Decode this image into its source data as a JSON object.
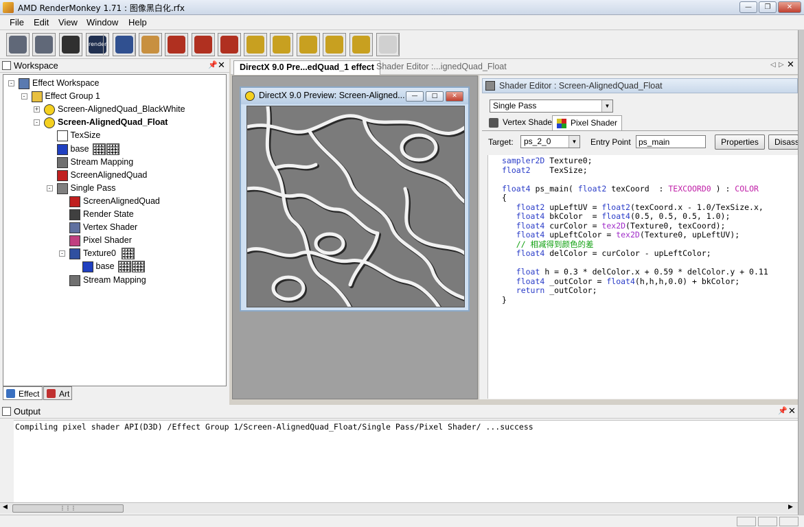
{
  "window": {
    "title": "AMD RenderMonkey 1.71 : 图像黑白化.rfx",
    "icon": "rendermonkey-app-icon"
  },
  "menu": [
    "File",
    "Edit",
    "View",
    "Window",
    "Help"
  ],
  "toolbar": {
    "buttons": [
      {
        "name": "add-vertex-shader-icon",
        "color": "#606878"
      },
      {
        "name": "add-pixel-shader-icon",
        "color": "#606878"
      },
      {
        "name": "compile-icon",
        "color": "#303030"
      },
      {
        "name": "render-icon",
        "color": "#203050",
        "label": "render"
      },
      {
        "name": "sphere-model-icon",
        "color": "#305090"
      },
      {
        "name": "palette-icon",
        "color": "#c89040"
      },
      {
        "name": "add-texture-icon",
        "color": "#b03020"
      },
      {
        "name": "add-variable-icon",
        "color": "#b03020"
      },
      {
        "name": "add-renderstate-icon",
        "color": "#b03020"
      },
      {
        "name": "camera-icon",
        "color": "#c8a020"
      },
      {
        "name": "camera-icon",
        "color": "#c8a020"
      },
      {
        "name": "camera-icon",
        "color": "#c8a020"
      },
      {
        "name": "camera-icon",
        "color": "#c8a020"
      },
      {
        "name": "camera-icon",
        "color": "#c8a020"
      },
      {
        "name": "mouse-icon",
        "color": "#d0d0d0"
      }
    ]
  },
  "workspace": {
    "title": "Workspace",
    "tree": [
      {
        "label": "Effect Workspace",
        "icon": "workspace-icon",
        "depth": 0,
        "expander": "-"
      },
      {
        "label": "Effect Group 1",
        "icon": "folder-icon",
        "depth": 1,
        "expander": "-"
      },
      {
        "label": "Screen-AlignedQuad_BlackWhite",
        "icon": "effect-icon",
        "depth": 2,
        "expander": "+"
      },
      {
        "label": "Screen-AlignedQuad_Float",
        "icon": "effect-icon",
        "depth": 2,
        "expander": "-",
        "bold": true
      },
      {
        "label": "TexSize",
        "icon": "variable-icon",
        "depth": 3
      },
      {
        "label": "base",
        "icon": "texture-icon",
        "depth": 3,
        "thumbs": 2
      },
      {
        "label": "Stream Mapping",
        "icon": "stream-mapping-icon",
        "depth": 3
      },
      {
        "label": "ScreenAlignedQuad",
        "icon": "model-icon",
        "depth": 3
      },
      {
        "label": "Single Pass",
        "icon": "pass-icon",
        "depth": 3,
        "expander": "-"
      },
      {
        "label": "ScreenAlignedQuad",
        "icon": "model-icon",
        "depth": 4
      },
      {
        "label": "Render State",
        "icon": "render-state-icon",
        "depth": 4
      },
      {
        "label": "Vertex Shader",
        "icon": "vertex-shader-icon",
        "depth": 4
      },
      {
        "label": "Pixel Shader",
        "icon": "pixel-shader-icon",
        "depth": 4
      },
      {
        "label": "Texture0",
        "icon": "texture-object-icon",
        "depth": 4,
        "expander": "-",
        "thumbs": 1
      },
      {
        "label": "base",
        "icon": "texture-icon",
        "depth": 5,
        "thumbs": 2
      },
      {
        "label": "Stream Mapping",
        "icon": "stream-mapping-icon",
        "depth": 4
      }
    ],
    "tabs": [
      {
        "label": "Effect",
        "icon": "effect-tab-icon",
        "color": "#3a70c0"
      },
      {
        "label": "Art",
        "icon": "art-tab-icon",
        "color": "#c03030"
      }
    ]
  },
  "documents": {
    "tabs": [
      "DirectX 9.0 Pre...edQuad_1 effect",
      "Shader Editor :...ignedQuad_Float"
    ],
    "preview": {
      "title": "DirectX 9.0 Preview: Screen-Aligned..."
    },
    "shader_editor": {
      "title": "Shader Editor : Screen-AlignedQuad_Float",
      "pass_select": "Single Pass",
      "tabs": [
        "Vertex Shader",
        "Pixel Shader"
      ],
      "target_label": "Target:",
      "target_value": "ps_2_0",
      "entry_label": "Entry Point",
      "entry_value": "ps_main",
      "properties_button": "Properties",
      "disassembly_button": "Disassembly",
      "code": [
        [
          [
            "kw",
            "sampler2D"
          ],
          [
            "t",
            " Texture0;"
          ]
        ],
        [
          [
            "kw",
            "float2"
          ],
          [
            "t",
            "    TexSize;"
          ]
        ],
        [],
        [
          [
            "kw",
            "float4"
          ],
          [
            "t",
            " ps_main( "
          ],
          [
            "kw",
            "float2"
          ],
          [
            "t",
            " texCoord  : "
          ],
          [
            "sem",
            "TEXCOORD0"
          ],
          [
            "t",
            " ) : "
          ],
          [
            "sem",
            "COLOR"
          ]
        ],
        [
          [
            "t",
            "{"
          ]
        ],
        [
          [
            "t",
            "   "
          ],
          [
            "kw",
            "float2"
          ],
          [
            "t",
            " upLeftUV = "
          ],
          [
            "kw",
            "float2"
          ],
          [
            "t",
            "(texCoord.x - 1.0/TexSize.x,"
          ]
        ],
        [
          [
            "t",
            "   "
          ],
          [
            "kw",
            "float4"
          ],
          [
            "t",
            " bkColor  = "
          ],
          [
            "kw",
            "float4"
          ],
          [
            "t",
            "(0.5, 0.5, 0.5, 1.0);"
          ]
        ],
        [
          [
            "t",
            "   "
          ],
          [
            "kw",
            "float4"
          ],
          [
            "t",
            " curColor = "
          ],
          [
            "fn",
            "tex2D"
          ],
          [
            "t",
            "(Texture0, texCoord);"
          ]
        ],
        [
          [
            "t",
            "   "
          ],
          [
            "kw",
            "float4"
          ],
          [
            "t",
            " upLeftColor = "
          ],
          [
            "fn",
            "tex2D"
          ],
          [
            "t",
            "(Texture0, upLeftUV);"
          ]
        ],
        [
          [
            "t",
            "   "
          ],
          [
            "cm",
            "// 相减得到颜色的差"
          ]
        ],
        [
          [
            "t",
            "   "
          ],
          [
            "kw",
            "float4"
          ],
          [
            "t",
            " delColor = curColor - upLeftColor;"
          ]
        ],
        [],
        [
          [
            "t",
            "   "
          ],
          [
            "kw",
            "float"
          ],
          [
            "t",
            " h = 0.3 * delColor.x + 0.59 * delColor.y + 0.11"
          ]
        ],
        [
          [
            "t",
            "   "
          ],
          [
            "kw",
            "float4"
          ],
          [
            "t",
            " _outColor = "
          ],
          [
            "kw",
            "float4"
          ],
          [
            "t",
            "(h,h,h,0.0) + bkColor;"
          ]
        ],
        [
          [
            "t",
            "   "
          ],
          [
            "kw",
            "return"
          ],
          [
            "t",
            " _outColor;"
          ]
        ],
        [
          [
            "t",
            "}"
          ]
        ]
      ]
    }
  },
  "output": {
    "title": "Output",
    "line": "Compiling pixel shader API(D3D) /Effect Group 1/Screen-AlignedQuad_Float/Single Pass/Pixel Shader/ ...success"
  }
}
